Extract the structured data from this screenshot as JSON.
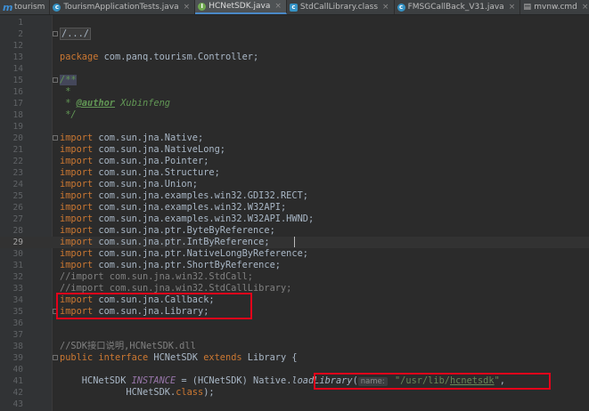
{
  "tabs": [
    {
      "label": "tourism",
      "icon": "module-icon",
      "active": false
    },
    {
      "label": "TourismApplicationTests.java",
      "icon": "class-icon",
      "active": false
    },
    {
      "label": "HCNetSDK.java",
      "icon": "interface-icon",
      "active": true
    },
    {
      "label": "StdCallLibrary.class",
      "icon": "compiled-class-icon",
      "active": false
    },
    {
      "label": "FMSGCallBack_V31.java",
      "icon": "class-icon",
      "active": false
    },
    {
      "label": "mvnw.cmd",
      "icon": "file-icon",
      "active": false
    },
    {
      "label": "mvr",
      "icon": "file-icon",
      "active": false
    }
  ],
  "editor": {
    "current_line": "29",
    "lines": [
      {
        "n": "1",
        "text": ""
      },
      {
        "n": "2",
        "text": "/.../"
      },
      {
        "n": "12",
        "text": ""
      },
      {
        "n": "13",
        "kw": "package",
        "text": " com.panq.tourism.Controller;"
      },
      {
        "n": "14",
        "text": ""
      },
      {
        "n": "15",
        "doc_open": "/**"
      },
      {
        "n": "16",
        "doc": " *"
      },
      {
        "n": "17",
        "doc_pre": " * ",
        "doc_tag": "@author",
        "doc_post": " Xubinfeng"
      },
      {
        "n": "18",
        "doc": " */"
      },
      {
        "n": "19",
        "text": ""
      },
      {
        "n": "20",
        "kw": "import",
        "text": " com.sun.jna.Native;"
      },
      {
        "n": "21",
        "kw": "import",
        "text": " com.sun.jna.NativeLong;"
      },
      {
        "n": "22",
        "kw": "import",
        "text": " com.sun.jna.Pointer;"
      },
      {
        "n": "23",
        "kw": "import",
        "text": " com.sun.jna.Structure;"
      },
      {
        "n": "24",
        "kw": "import",
        "text": " com.sun.jna.Union;"
      },
      {
        "n": "25",
        "kw": "import",
        "text": " com.sun.jna.examples.win32.GDI32.RECT;"
      },
      {
        "n": "26",
        "kw": "import",
        "text": " com.sun.jna.examples.win32.W32API;"
      },
      {
        "n": "27",
        "kw": "import",
        "text": " com.sun.jna.examples.win32.W32API.HWND;"
      },
      {
        "n": "28",
        "kw": "import",
        "text": " com.sun.jna.ptr.ByteByReference;"
      },
      {
        "n": "29",
        "kw": "import",
        "text": " com.sun.jna.ptr.IntByReference;"
      },
      {
        "n": "30",
        "kw": "import",
        "text": " com.sun.jna.ptr.NativeLongByReference;"
      },
      {
        "n": "31",
        "kw": "import",
        "text": " com.sun.jna.ptr.ShortByReference;"
      },
      {
        "n": "32",
        "comment": "//import com.sun.jna.win32.StdCall;"
      },
      {
        "n": "33",
        "comment": "//import com.sun.jna.win32.StdCallLibrary;"
      },
      {
        "n": "34",
        "kw": "import",
        "text": " com.sun.jna.Callback;"
      },
      {
        "n": "35",
        "kw": "import",
        "text": " com.sun.jna.Library;"
      },
      {
        "n": "36",
        "text": ""
      },
      {
        "n": "37",
        "text": ""
      },
      {
        "n": "38",
        "comment": "//SDK接口说明,HCNetSDK.dll"
      },
      {
        "n": "39",
        "iface": true
      },
      {
        "n": "40",
        "text": ""
      },
      {
        "n": "41",
        "instance": true
      },
      {
        "n": "42",
        "cont": true
      },
      {
        "n": "43",
        "text": ""
      }
    ],
    "interface_decl": {
      "kw1": "public",
      "kw2": "interface",
      "name": " HCNetSDK ",
      "kw3": "extends",
      "rest": " Library {"
    },
    "instance_decl": {
      "prefix": "    HCNetSDK ",
      "field": "INSTANCE",
      "mid": " = (HCNetSDK) Native.",
      "method": "loadLibrary",
      "paren": "(",
      "hint": "name:",
      "str_pre": " \"/usr/lib/",
      "str_u": "hcnetsdk",
      "str_post": "\"",
      "tail": ","
    },
    "cont_decl": {
      "pre": "            HCNetSDK.",
      "kw": "class",
      "post": ");"
    }
  }
}
